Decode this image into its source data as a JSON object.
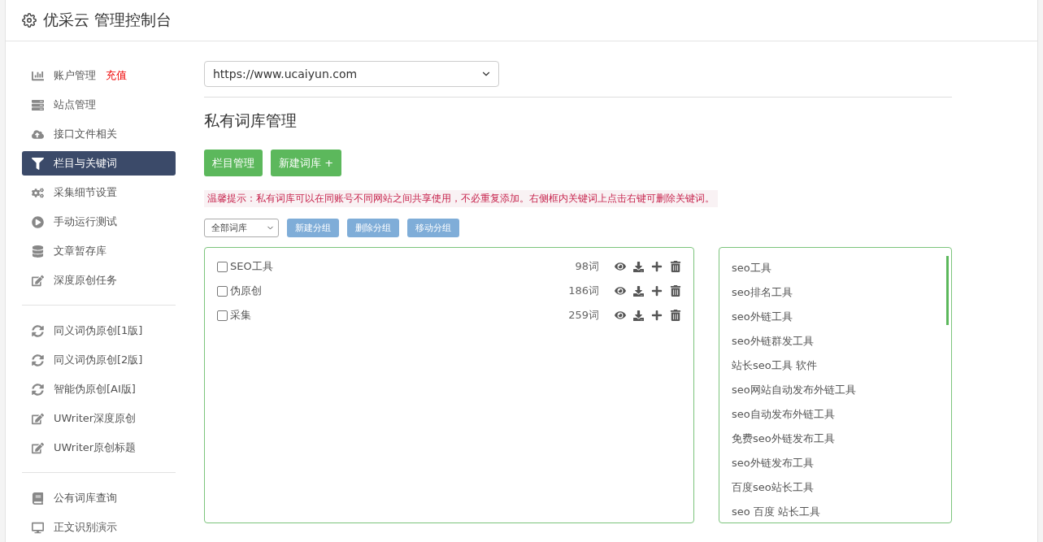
{
  "header": {
    "title": "优采云 管理控制台"
  },
  "sidebar": {
    "groups": [
      {
        "items": [
          {
            "label": "账户管理",
            "badge": "充值",
            "kind": "chart",
            "selected": false
          },
          {
            "label": "站点管理",
            "kind": "server",
            "selected": false
          },
          {
            "label": "接口文件相关",
            "kind": "cloud",
            "selected": false
          },
          {
            "label": "栏目与关键词",
            "kind": "filter",
            "selected": true
          },
          {
            "label": "采集细节设置",
            "kind": "gears",
            "selected": false
          },
          {
            "label": "手动运行测试",
            "kind": "play",
            "selected": false
          },
          {
            "label": "文章暂存库",
            "kind": "database",
            "selected": false
          },
          {
            "label": "深度原创任务",
            "kind": "edit",
            "selected": false
          }
        ]
      },
      {
        "items": [
          {
            "label": "同义词伪原创[1版]",
            "kind": "refresh",
            "selected": false
          },
          {
            "label": "同义词伪原创[2版]",
            "kind": "refresh",
            "selected": false
          },
          {
            "label": "智能伪原创[AI版]",
            "kind": "refresh",
            "selected": false
          },
          {
            "label": "UWriter深度原创",
            "kind": "edit",
            "selected": false
          },
          {
            "label": "UWriter原创标题",
            "kind": "edit",
            "selected": false
          }
        ]
      },
      {
        "items": [
          {
            "label": "公有词库查询",
            "kind": "book",
            "selected": false
          },
          {
            "label": "正文识别演示",
            "kind": "monitor",
            "selected": false
          }
        ]
      }
    ]
  },
  "site_select": {
    "value": "https://www.ucaiyun.com"
  },
  "section_title": "私有词库管理",
  "primary_buttons": [
    "栏目管理",
    "新建词库 +"
  ],
  "notice": "温馨提示：私有词库可以在同账号不同网站之间共享使用，不必重复添加。右侧框内关键词上点击右键可删除关键词。",
  "group_select": {
    "value": "全部词库"
  },
  "group_buttons": [
    "新建分组",
    "删除分组",
    "移动分组"
  ],
  "libraries": [
    {
      "name": "SEO工具",
      "count": "98词",
      "checked": false
    },
    {
      "name": "伪原创",
      "count": "186词",
      "checked": false
    },
    {
      "name": "采集",
      "count": "259词",
      "checked": false
    }
  ],
  "keywords": [
    "seo工具",
    "seo排名工具",
    "seo外链工具",
    "seo外链群发工具",
    "站长seo工具 软件",
    "seo网站自动发布外链工具",
    "seo自动发布外链工具",
    "免费seo外链发布工具",
    "seo外链发布工具",
    "百度seo站长工具",
    "seo 百度 站长工具"
  ]
}
